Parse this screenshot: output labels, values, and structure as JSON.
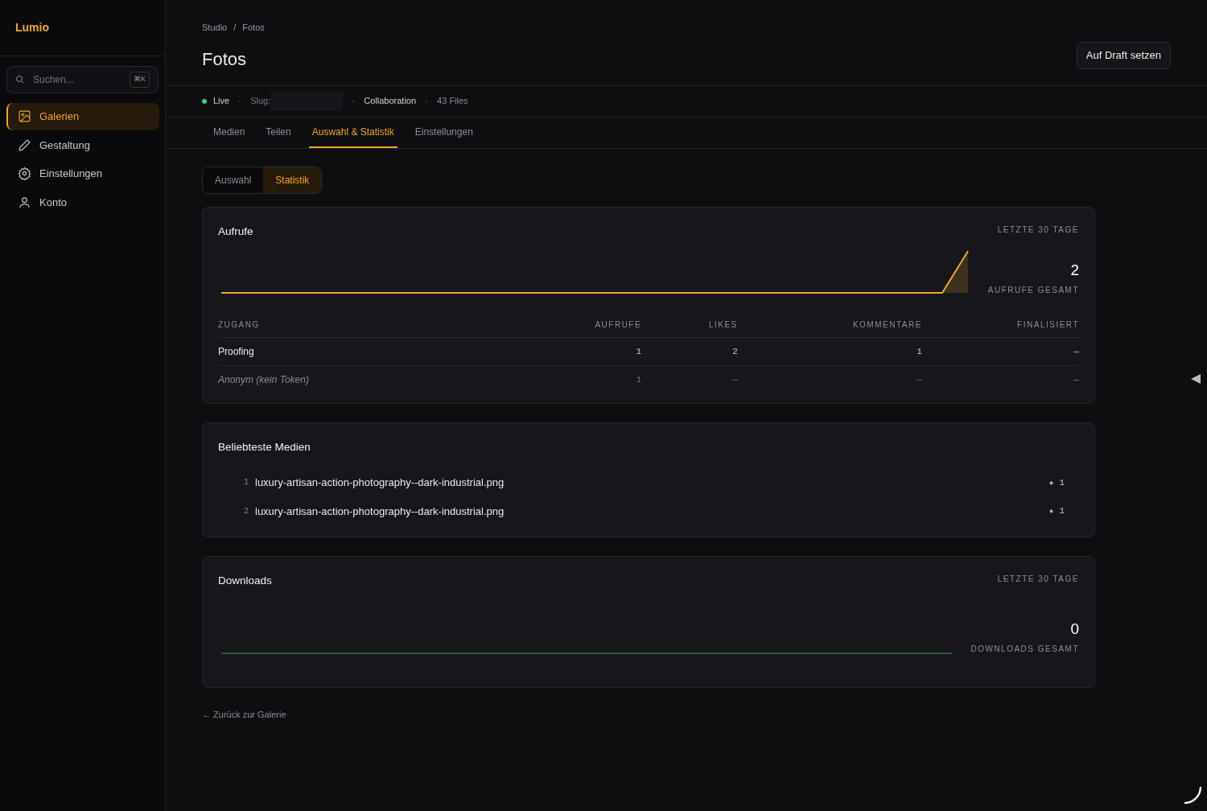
{
  "brand": "Lumio",
  "search": {
    "placeholder": "Suchen...",
    "shortcut": "⌘K"
  },
  "nav": [
    {
      "label": "Galerien",
      "kind": "image",
      "selected": true
    },
    {
      "label": "Gestaltung",
      "kind": "pencil",
      "selected": false
    },
    {
      "label": "Einstellungen",
      "kind": "gear",
      "selected": false
    },
    {
      "label": "Konto",
      "kind": "person",
      "selected": false
    }
  ],
  "breadcrumb": [
    "Studio",
    "Fotos"
  ],
  "breadcrumb_separator": "/",
  "title": "Fotos",
  "action_button": "Auf Draft setzen",
  "meta": {
    "status": "Live",
    "slug_label": "Slug:",
    "items": [
      "Collaboration",
      "43 Files"
    ]
  },
  "tabs": [
    {
      "label": "Medien",
      "selected": false
    },
    {
      "label": "Teilen",
      "selected": false
    },
    {
      "label": "Auswahl & Statistik",
      "selected": true
    },
    {
      "label": "Einstellungen",
      "selected": false
    }
  ],
  "segments": [
    {
      "label": "Auswahl",
      "selected": false
    },
    {
      "label": "Statistik",
      "selected": true
    }
  ],
  "views": {
    "title": "Aufrufe",
    "period": "LETZTE 30 TAGE",
    "total": "2",
    "total_label": "AUFRUFE GESAMT",
    "columns": [
      "ZUGANG",
      "AUFRUFE",
      "LIKES",
      "KOMMENTARE",
      "FINALISIERT"
    ],
    "rows": [
      {
        "kind": "token",
        "cells": [
          "Proofing",
          "1",
          "2",
          "1",
          "—"
        ]
      },
      {
        "kind": "anonymous",
        "cells": [
          "Anonym (kein Token)",
          "1",
          "—",
          "—",
          "—"
        ]
      }
    ]
  },
  "popular": {
    "title": "Beliebteste Medien",
    "items": [
      {
        "rank": "1",
        "name": "luxury-artisan-action-photography--dark-industrial.png",
        "likes": "★ 1"
      },
      {
        "rank": "2",
        "name": "luxury-artisan-action-photography--dark-industrial.png",
        "likes": "★ 1"
      }
    ]
  },
  "downloads": {
    "title": "Downloads",
    "period": "LETZTE 30 TAGE",
    "total": "0",
    "total_label": "DOWNLOADS GESAMT"
  },
  "back_link": "← Zurück zur Galerie"
}
